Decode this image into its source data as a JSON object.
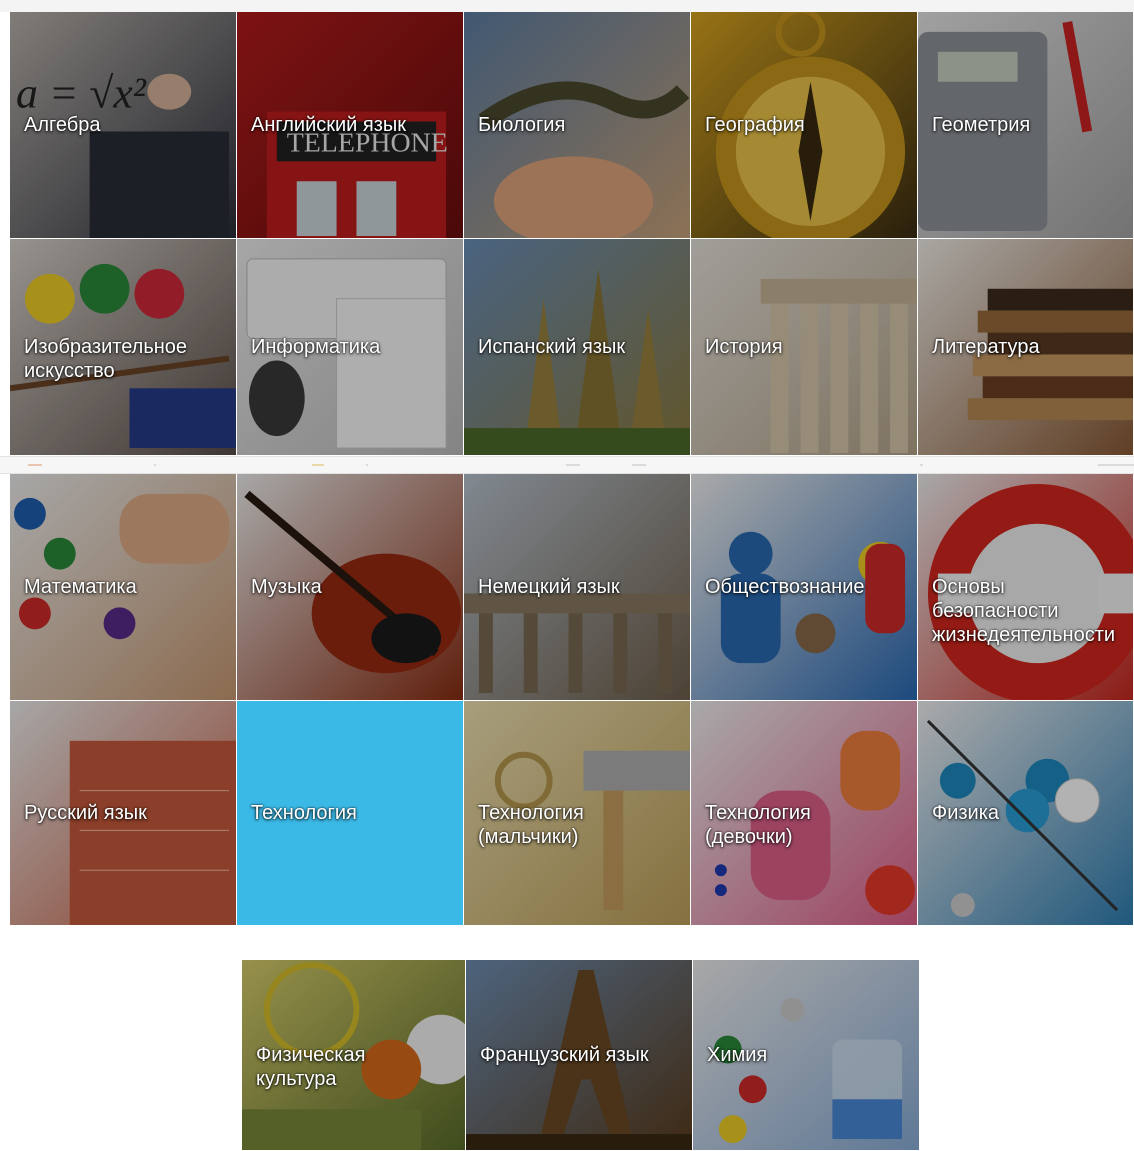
{
  "subjects": [
    {
      "label": "Алгебра",
      "icon": "algebra-photo",
      "bg": [
        "#b9b3ad",
        "#2c2f3a"
      ]
    },
    {
      "label": "Английский язык",
      "icon": "phone-booth-photo",
      "bg": [
        "#b41c1c",
        "#6b0d0d"
      ]
    },
    {
      "label": "Биология",
      "icon": "lizard-photo",
      "bg": [
        "#5d7fa4",
        "#c9a37a"
      ]
    },
    {
      "label": "География",
      "icon": "compass-photo",
      "bg": [
        "#d9a520",
        "#3b2e12"
      ]
    },
    {
      "label": "Геометрия",
      "icon": "calculator-photo",
      "bg": [
        "#e6e6e6",
        "#a5a5a5"
      ]
    },
    {
      "label": "Изобразительное\nискусство",
      "icon": "paints-photo",
      "bg": [
        "#d8d2cc",
        "#5a4e48"
      ]
    },
    {
      "label": "Информатика",
      "icon": "keyboard-photo",
      "bg": [
        "#eeeeee",
        "#bdbdbd"
      ]
    },
    {
      "label": "Испанский язык",
      "icon": "sagrada-familia-photo",
      "bg": [
        "#6a8fb8",
        "#8e7b3e"
      ]
    },
    {
      "label": "История",
      "icon": "parthenon-photo",
      "bg": [
        "#e7e3dc",
        "#b6a58b"
      ]
    },
    {
      "label": "Литература",
      "icon": "books-photo",
      "bg": [
        "#f2efe9",
        "#8a5a35"
      ]
    },
    {
      "label": "Математика",
      "icon": "abacus-photo",
      "bg": [
        "#efefef",
        "#c89a72"
      ]
    },
    {
      "label": "Музыка",
      "icon": "violin-photo",
      "bg": [
        "#f0f0f0",
        "#8a2d12"
      ]
    },
    {
      "label": "Немецкий язык",
      "icon": "brandenburg-gate-photo",
      "bg": [
        "#b9c4cf",
        "#6f5f4b"
      ]
    },
    {
      "label": "Обществознание",
      "icon": "figures-photo",
      "bg": [
        "#f3f3f3",
        "#2a6ab4"
      ]
    },
    {
      "label": "Основы\nбезопасности\nжизнедеятельности",
      "icon": "lifebuoy-photo",
      "bg": [
        "#f1f1f1",
        "#c8281f"
      ]
    },
    {
      "label": "Русский язык",
      "icon": "copybook-photo",
      "bg": [
        "#efefef",
        "#c85a3c"
      ]
    },
    {
      "label": "Технология",
      "icon": "technology-tile",
      "bg": [
        "#3bb9e6",
        "#3bb9e6"
      ],
      "active": true
    },
    {
      "label": "Технология\n(мальчики)",
      "icon": "tools-photo",
      "bg": [
        "#f0e2b3",
        "#bfa25a"
      ]
    },
    {
      "label": "Технология\n(девочки)",
      "icon": "threads-photo",
      "bg": [
        "#f2f2f2",
        "#e0608a"
      ]
    },
    {
      "label": "Физика",
      "icon": "atom-model-photo",
      "bg": [
        "#f4f4f4",
        "#2f7fb3"
      ]
    },
    {
      "label": "Физическая\nкультура",
      "icon": "sports-photo",
      "bg": [
        "#d8cf6c",
        "#5a6d2a"
      ]
    },
    {
      "label": "Французский язык",
      "icon": "eiffel-tower-photo",
      "bg": [
        "#6f8fb3",
        "#5a3c1c"
      ]
    },
    {
      "label": "Химия",
      "icon": "molecule-photo",
      "bg": [
        "#f0f0f0",
        "#8aaed8"
      ]
    }
  ],
  "colors": {
    "overlay": "#000000",
    "label_text": "#ffffff",
    "active_tile": "#3bb9e6"
  }
}
